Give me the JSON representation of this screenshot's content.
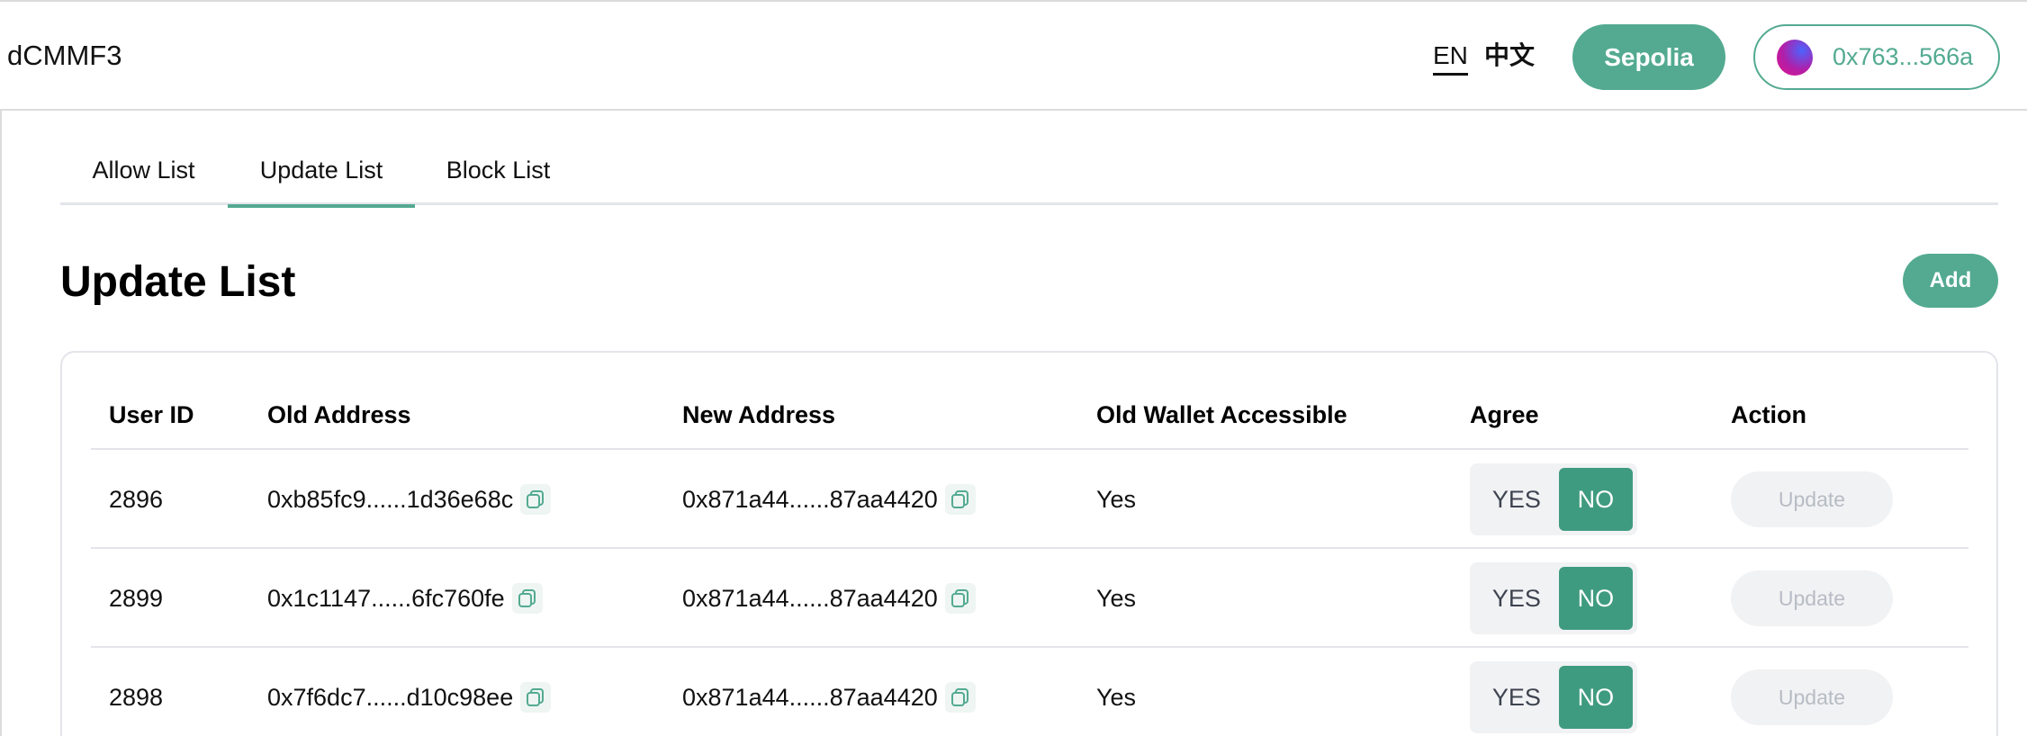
{
  "header": {
    "app_title": "dCMMF3",
    "lang_en": "EN",
    "lang_zh": "中文",
    "network_label": "Sepolia",
    "wallet_address": "0x763...566a"
  },
  "tabs": [
    {
      "label": "Allow List",
      "active": false
    },
    {
      "label": "Update List",
      "active": true
    },
    {
      "label": "Block List",
      "active": false
    }
  ],
  "page": {
    "title": "Update List",
    "add_label": "Add"
  },
  "table": {
    "headers": [
      "User ID",
      "Old Address",
      "New Address",
      "Old Wallet Accessible",
      "Agree",
      "Action"
    ],
    "rows": [
      {
        "user_id": "2896",
        "old_address": "0xb85fc9......1d36e68c",
        "new_address": "0x871a44......87aa4420",
        "old_wallet_accessible": "Yes",
        "agree_yes": "YES",
        "agree_no": "NO",
        "agree_selected": "NO",
        "action": "Update"
      },
      {
        "user_id": "2899",
        "old_address": "0x1c1147......6fc760fe",
        "new_address": "0x871a44......87aa4420",
        "old_wallet_accessible": "Yes",
        "agree_yes": "YES",
        "agree_no": "NO",
        "agree_selected": "NO",
        "action": "Update"
      },
      {
        "user_id": "2898",
        "old_address": "0x7f6dc7......d10c98ee",
        "new_address": "0x871a44......87aa4420",
        "old_wallet_accessible": "Yes",
        "agree_yes": "YES",
        "agree_no": "NO",
        "agree_selected": "NO",
        "action": "Update"
      }
    ]
  },
  "colors": {
    "accent": "#53aa91",
    "accent_dark": "#3f9b7f",
    "border": "#e3e5ea",
    "disabled_bg": "#f1f2f4",
    "disabled_text": "#b7bcc4"
  },
  "icons": {
    "copy": "copy-icon",
    "wallet_avatar": "wallet-avatar"
  }
}
